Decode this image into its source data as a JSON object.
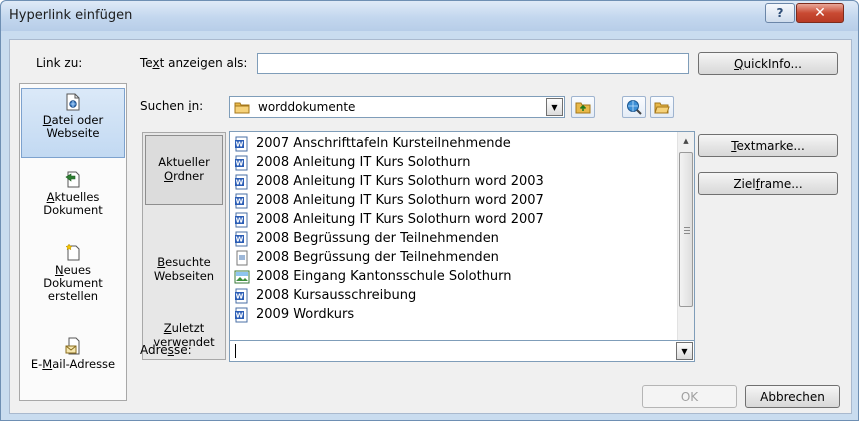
{
  "window": {
    "title": "Hyperlink einfügen",
    "help_label": "?",
    "close_label": "✕"
  },
  "link_to": {
    "label": "Link zu:",
    "items": [
      {
        "label_html_a": "",
        "label": "Datei oder Webseite",
        "icon": "document-web-icon",
        "selected": true
      },
      {
        "label": "Aktuelles Dokument",
        "icon": "current-document-icon",
        "selected": false
      },
      {
        "label": "Neues Dokument erstellen",
        "icon": "new-document-icon",
        "selected": false
      },
      {
        "label": "E-Mail-Adresse",
        "icon": "email-icon",
        "selected": false
      }
    ]
  },
  "display_text": {
    "label": "Text anzeigen als:",
    "value": ""
  },
  "quickinfo_button": "QuickInfo...",
  "look_in": {
    "label": "Suchen in:",
    "value": "worddokumente",
    "folder_icon": "folder-icon"
  },
  "toolbar_icons": [
    "up-folder-icon",
    "browse-web-icon",
    "browse-file-icon"
  ],
  "tabs": [
    {
      "label": "Aktueller Ordner",
      "selected": true
    },
    {
      "label": "Besuchte Webseiten",
      "selected": false
    },
    {
      "label": "Zuletzt verwendet",
      "selected": false
    }
  ],
  "files": [
    {
      "name": "2007 Anschrifttafeln Kursteilnehmende",
      "icon": "word-doc-icon"
    },
    {
      "name": "2008 Anleitung IT Kurs Solothurn",
      "icon": "word-doc-icon"
    },
    {
      "name": "2008 Anleitung IT Kurs Solothurn word 2003",
      "icon": "word-doc-icon"
    },
    {
      "name": "2008 Anleitung IT Kurs Solothurn word 2007",
      "icon": "word-doc-icon"
    },
    {
      "name": "2008 Anleitung IT Kurs Solothurn word 2007",
      "icon": "word-doc-icon"
    },
    {
      "name": "2008 Begrüssung der Teilnehmenden",
      "icon": "word-doc-icon"
    },
    {
      "name": "2008 Begrüssung der Teilnehmenden",
      "icon": "generic-doc-icon"
    },
    {
      "name": "2008 Eingang Kantonsschule Solothurn",
      "icon": "image-file-icon"
    },
    {
      "name": "2008 Kursausschreibung",
      "icon": "word-doc-icon"
    },
    {
      "name": "2009 Wordkurs",
      "icon": "word-doc-icon"
    }
  ],
  "side_buttons": {
    "bookmark": "Textmarke...",
    "target_frame": "Zielframe..."
  },
  "address": {
    "label": "Adresse:",
    "value": ""
  },
  "footer": {
    "ok": "OK",
    "cancel": "Abbrechen"
  }
}
